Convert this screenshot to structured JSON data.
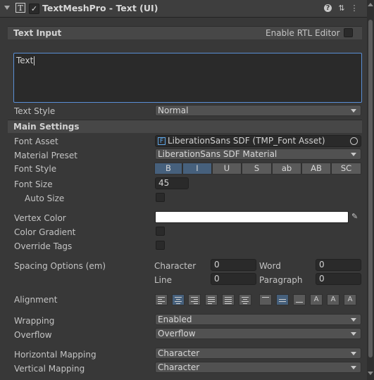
{
  "component": {
    "title": "TextMeshPro - Text (UI)",
    "enabled_check": "✓",
    "icon_glyph": "T",
    "help_glyph": "?",
    "preset_glyph": "⇅",
    "menu_glyph": "⋮"
  },
  "text_input": {
    "section": "Text Input",
    "rtl_label": "Enable RTL Editor",
    "value": "Text",
    "text_style_label": "Text Style",
    "text_style_value": "Normal"
  },
  "main_settings": {
    "section": "Main Settings",
    "font_asset_label": "Font Asset",
    "font_asset_value": "LiberationSans SDF (TMP_Font Asset)",
    "material_preset_label": "Material Preset",
    "material_preset_value": "LiberationSans SDF Material",
    "font_style_label": "Font Style",
    "font_style_buttons": [
      "B",
      "I",
      "U",
      "S",
      "ab",
      "AB",
      "SC"
    ],
    "font_size_label": "Font Size",
    "font_size_value": "45",
    "auto_size_label": "Auto Size",
    "vertex_color_label": "Vertex Color",
    "vertex_color": "#ffffff",
    "color_gradient_label": "Color Gradient",
    "override_tags_label": "Override Tags",
    "spacing_label": "Spacing Options (em)",
    "spacing": {
      "character_label": "Character",
      "character_value": "0",
      "word_label": "Word",
      "word_value": "0",
      "line_label": "Line",
      "line_value": "0",
      "paragraph_label": "Paragraph",
      "paragraph_value": "0"
    },
    "alignment_label": "Alignment",
    "wrapping_label": "Wrapping",
    "wrapping_value": "Enabled",
    "overflow_label": "Overflow",
    "overflow_value": "Overflow",
    "horizontal_mapping_label": "Horizontal Mapping",
    "horizontal_mapping_value": "Character",
    "vertical_mapping_label": "Vertical Mapping",
    "vertical_mapping_value": "Character"
  },
  "colors": {
    "selected_button": "#46607c",
    "focus_border": "#5a8fd6",
    "font_asset_icon": "#5fa7e8"
  }
}
